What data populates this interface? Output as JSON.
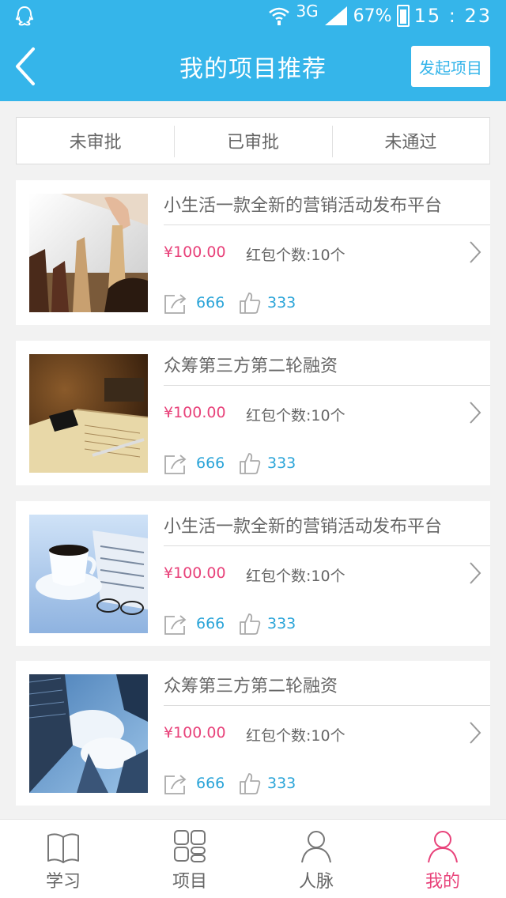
{
  "status_bar": {
    "network": "3G",
    "battery": "67%",
    "time": "15 : 23"
  },
  "header": {
    "title": "我的项目推荐",
    "action_label": "发起项目"
  },
  "tabs": [
    {
      "label": "未审批"
    },
    {
      "label": "已审批"
    },
    {
      "label": "未通过"
    }
  ],
  "projects": [
    {
      "title": "小生活一款全新的营销活动发布平台",
      "price": "¥100.00",
      "redpack": "红包个数:10个",
      "shares": "666",
      "likes": "333",
      "image": "chess-photo"
    },
    {
      "title": "众筹第三方第二轮融资",
      "price": "¥100.00",
      "redpack": "红包个数:10个",
      "shares": "666",
      "likes": "333",
      "image": "notebook-phone-photo"
    },
    {
      "title": "小生活一款全新的营销活动发布平台",
      "price": "¥100.00",
      "redpack": "红包个数:10个",
      "shares": "666",
      "likes": "333",
      "image": "coffee-newspaper-photo"
    },
    {
      "title": "众筹第三方第二轮融资",
      "price": "¥100.00",
      "redpack": "红包个数:10个",
      "shares": "666",
      "likes": "333",
      "image": "skyscrapers-photo"
    }
  ],
  "tabbar": [
    {
      "label": "学习",
      "icon": "book-icon"
    },
    {
      "label": "项目",
      "icon": "grid-icon"
    },
    {
      "label": "人脉",
      "icon": "person-icon"
    },
    {
      "label": "我的",
      "icon": "person-icon",
      "active": true
    }
  ],
  "colors": {
    "header": "#35b5ea",
    "price": "#e8427a",
    "counts": "#2aa4d8",
    "active_tab": "#e8427a"
  }
}
